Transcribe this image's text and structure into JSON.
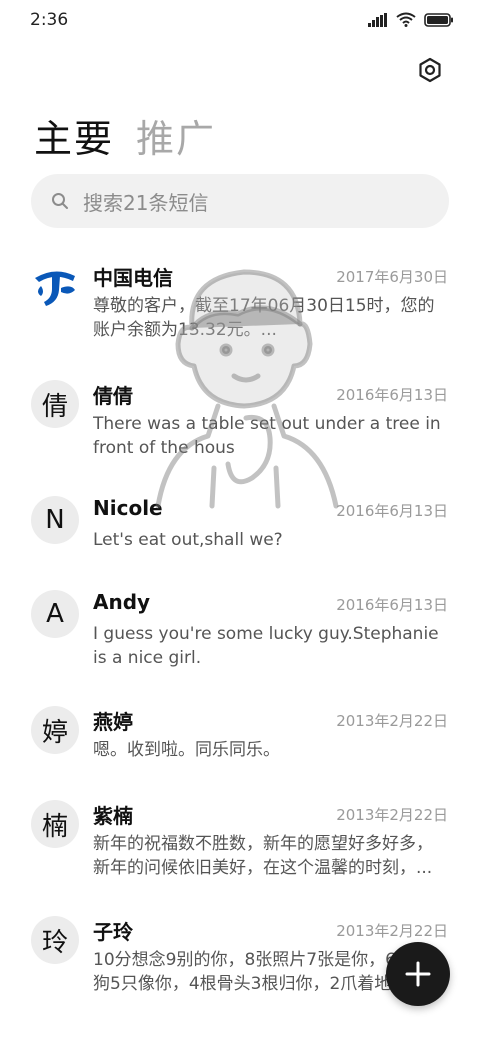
{
  "status_bar": {
    "time": "2:36"
  },
  "header": {
    "tabs": [
      {
        "label": "主要",
        "active": true
      },
      {
        "label": "推广",
        "active": false
      }
    ]
  },
  "search": {
    "placeholder": "搜索21条短信"
  },
  "conversations": [
    {
      "avatar": "",
      "avatar_type": "china-telecom-logo",
      "name": "中国电信",
      "date": "2017年6月30日",
      "preview": "尊敬的客户，截至17年06月30日15时，您的账户余额为13.32元。..."
    },
    {
      "avatar": "倩",
      "name": "倩倩",
      "date": "2016年6月13日",
      "preview": "There was a table set out under a tree in front of the hous"
    },
    {
      "avatar": "N",
      "name": "Nicole",
      "date": "2016年6月13日",
      "preview": "Let's eat out,shall we?"
    },
    {
      "avatar": "A",
      "name": "Andy",
      "date": "2016年6月13日",
      "preview": "I guess you're some lucky guy.Stephanie is a nice girl."
    },
    {
      "avatar": "婷",
      "name": "燕婷",
      "date": "2013年2月22日",
      "preview": "嗯。收到啦。同乐同乐。"
    },
    {
      "avatar": "楠",
      "name": "紫楠",
      "date": "2013年2月22日",
      "preview": "新年的祝福数不胜数，新年的愿望好多好多，新年的问候依旧美好，在这个温馨的时刻，..."
    },
    {
      "avatar": "玲",
      "name": "子玲",
      "date": "2013年2月22日",
      "preview": "10分想念9别的你，8张照片7张是你，6条小狗5只像你，4根骨头3根归你，2爪着地"
    }
  ],
  "colors": {
    "accent": "#1a1a1a",
    "telecom_blue": "#0a58b8"
  }
}
